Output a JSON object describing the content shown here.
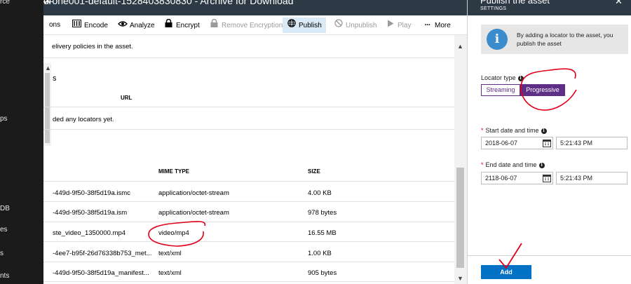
{
  "left_nav": {
    "items": [
      "rce",
      "ps",
      "DB",
      "es",
      "s",
      "nts"
    ]
  },
  "blade": {
    "title": "drone001-default-1528403830830 - Archive for Download",
    "toolbar": [
      {
        "label": "ons",
        "icon": ""
      },
      {
        "label": "Encode",
        "icon": "encode-icon"
      },
      {
        "label": "Analyze",
        "icon": "eye-icon"
      },
      {
        "label": "Encrypt",
        "icon": "lock-icon"
      },
      {
        "label": "Remove Encryption",
        "icon": "lock-icon",
        "disabled": true
      },
      {
        "label": "Publish",
        "icon": "globe-icon",
        "active": true
      },
      {
        "label": "Unpublish",
        "icon": "block-icon",
        "disabled": true
      },
      {
        "label": "Play",
        "icon": "play-icon",
        "disabled": true
      },
      {
        "label": "More",
        "icon": "more-icon"
      }
    ],
    "delivery_text": "elivery policies in the asset.",
    "locators_heading": "s",
    "locators_url_header": "URL",
    "locators_empty": "ded any locators yet.",
    "files_headers": {
      "mime": "MIME TYPE",
      "size": "SIZE"
    },
    "files": [
      {
        "name": "-449d-9f50-38f5d19a.ismc",
        "mime": "application/octet-stream",
        "size": "4.00 KB"
      },
      {
        "name": "-449d-9f50-38f5d19a.ism",
        "mime": "application/octet-stream",
        "size": "978 bytes"
      },
      {
        "name": "ste_video_1350000.mp4",
        "mime": "video/mp4",
        "size": "16.55 MB"
      },
      {
        "name": "-4ee7-b95f-26d76338b753_met...",
        "mime": "text/xml",
        "size": "1.00 KB"
      },
      {
        "name": "-449d-9f50-38f5d19a_manifest...",
        "mime": "text/xml",
        "size": "905 bytes"
      }
    ]
  },
  "panel": {
    "title": "Publish the asset",
    "subtitle": "SETTINGS",
    "info_text": "By adding a locator to the asset, you publish the asset",
    "locator_type_label": "Locator type",
    "locator_options": [
      "Streaming",
      "Progressive"
    ],
    "locator_selected": "Progressive",
    "start_label": "Start date and time",
    "start_date": "2018-06-07",
    "start_time": "5:21:43 PM",
    "end_label": "End date and time",
    "end_date": "2118-06-07",
    "end_time": "5:21:43 PM",
    "add_label": "Add"
  },
  "colors": {
    "accent": "#5f2e86",
    "primary_button": "#0072c6",
    "title_bar": "#2d3a46",
    "annotation": "#e0001b"
  }
}
